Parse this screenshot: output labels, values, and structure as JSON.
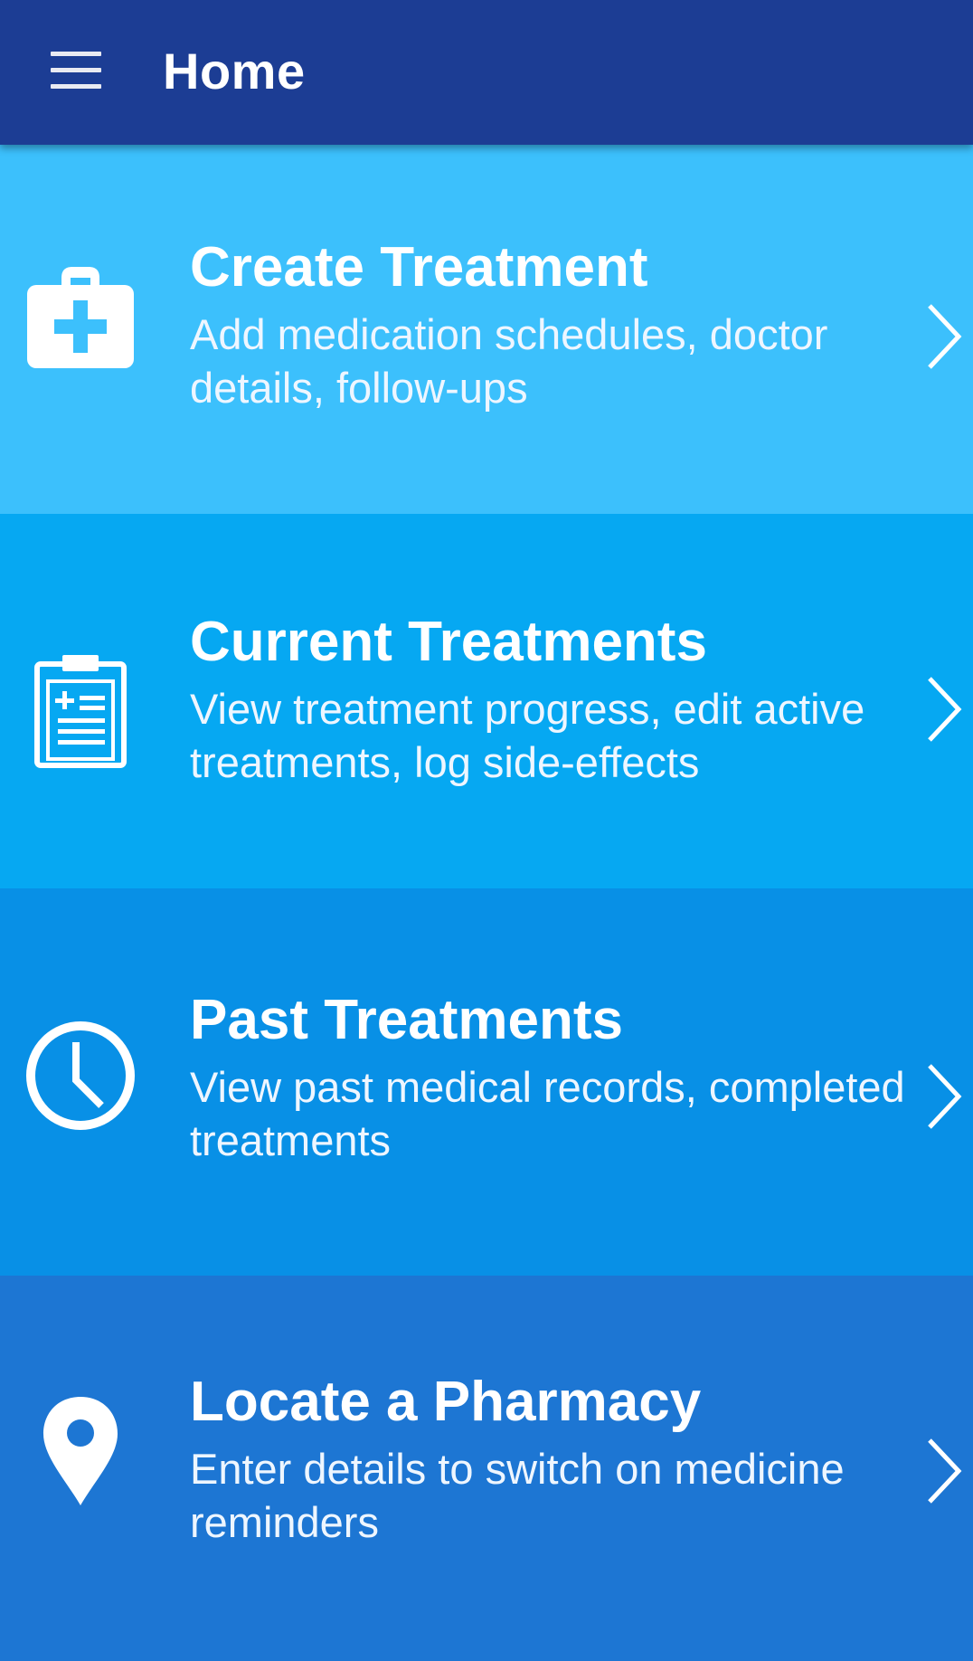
{
  "app_bar": {
    "title": "Home",
    "menu_icon": "hamburger-menu-icon"
  },
  "colors": {
    "app_bar": "#1c3d94",
    "card_create": "#3cc0fc",
    "card_current": "#06a8f2",
    "card_past": "#0890e6",
    "card_pharmacy": "#1d76d3",
    "foreground": "#ffffff"
  },
  "cards": [
    {
      "icon": "medical-kit-icon",
      "title": "Create Treatment",
      "description": "Add medication schedules, doctor details, follow-ups"
    },
    {
      "icon": "clipboard-icon",
      "title": "Current Treatments",
      "description": "View treatment progress, edit active treatments, log side-effects"
    },
    {
      "icon": "clock-icon",
      "title": "Past Treatments",
      "description": "View past medical records, completed treatments"
    },
    {
      "icon": "location-pin-icon",
      "title": "Locate a Pharmacy",
      "description": "Enter details to switch on medicine reminders"
    }
  ]
}
